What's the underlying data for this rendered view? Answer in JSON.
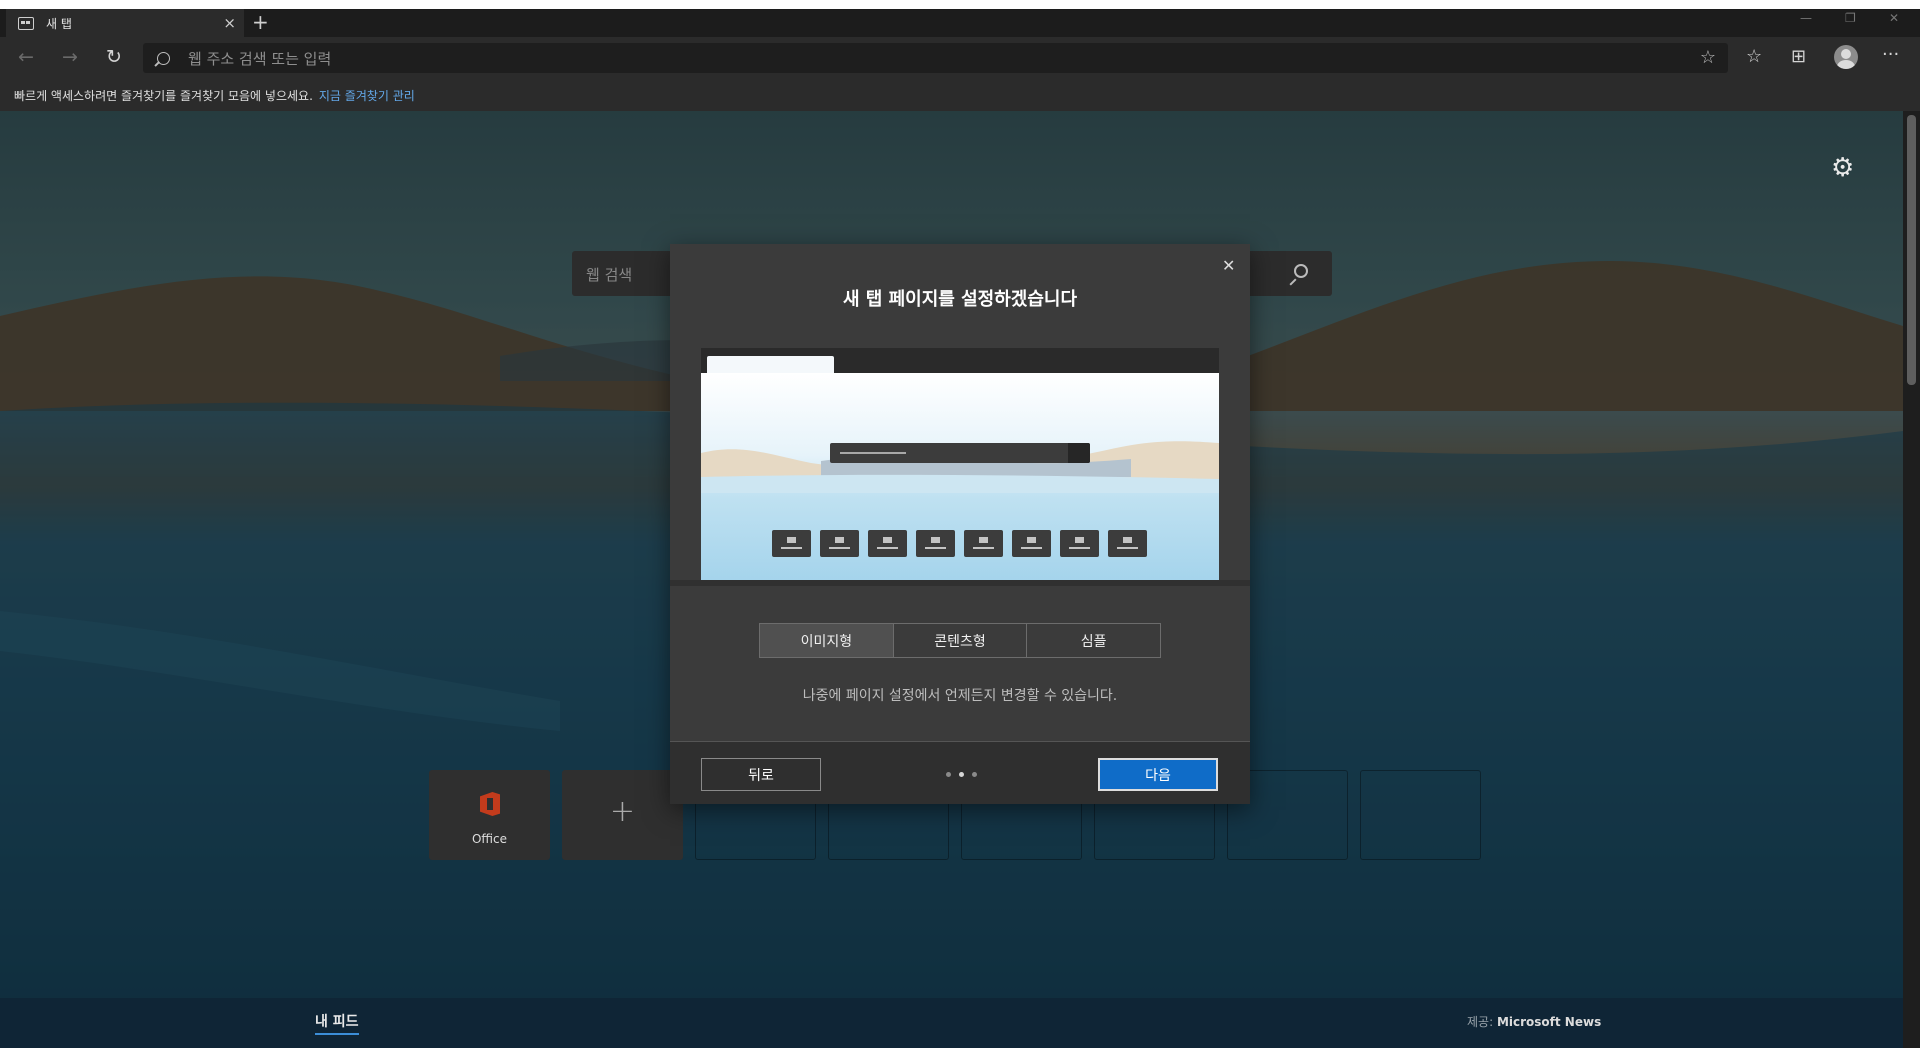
{
  "tab": {
    "title": "새 탭",
    "close_glyph": "×",
    "new_tab_glyph": "+"
  },
  "window_controls": {
    "minimize": "—",
    "restore": "❐",
    "close": "✕"
  },
  "nav": {
    "back": "←",
    "forward": "→",
    "refresh": "↻"
  },
  "address_bar": {
    "placeholder": "웹 주소 검색 또는 입력",
    "favorite_glyph": "☆"
  },
  "toolbar": {
    "favorites_glyph": "☆",
    "collections_glyph": "⊞",
    "more_glyph": "···"
  },
  "favorites_bar": {
    "message": "빠르게 액세스하려면 즐겨찾기를 즐겨찾기 모음에 넣으세요.",
    "link": "지금 즐겨찾기 관리"
  },
  "page": {
    "settings_glyph": "⚙",
    "search_placeholder": "웹 검색",
    "tiles": [
      {
        "label": "Office"
      },
      {
        "label": "+"
      }
    ],
    "feed_tab": "내 피드",
    "credit_prefix": "제공:",
    "credit_source": "Microsoft News"
  },
  "dialog": {
    "close_glyph": "✕",
    "title": "새 탭 페이지를 설정하겠습니다",
    "layout_options": [
      {
        "label": "이미지형",
        "selected": true
      },
      {
        "label": "콘텐츠형",
        "selected": false
      },
      {
        "label": "심플",
        "selected": false
      }
    ],
    "note": "나중에 페이지 설정에서 언제든지 변경할 수 있습니다.",
    "back_label": "뒤로",
    "next_label": "다음",
    "steps_total": 3,
    "current_step": 2
  },
  "colors": {
    "accent": "#0f6cc8",
    "link": "#63a8e8",
    "office": "#c33b1c"
  }
}
